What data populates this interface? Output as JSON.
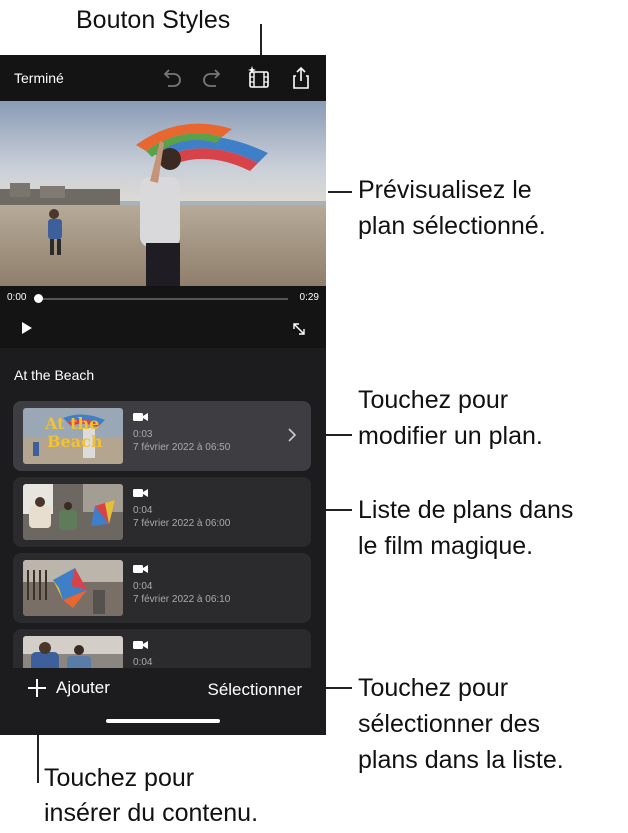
{
  "callouts": {
    "styles": "Bouton Styles",
    "preview_1": "Prévisualisez le",
    "preview_2": "plan sélectionné.",
    "edit_1": "Touchez pour",
    "edit_2": "modifier un plan.",
    "list_1": "Liste de plans dans",
    "list_2": "le film magique.",
    "select_1": "Touchez pour",
    "select_2": "sélectionner des",
    "select_3": "plans dans la liste.",
    "insert_1": "Touchez pour",
    "insert_2": "insérer du contenu."
  },
  "toolbar": {
    "done_label": "Terminé",
    "icons": [
      "undo-icon",
      "redo-icon",
      "styles-icon",
      "share-icon"
    ]
  },
  "player": {
    "time_start": "0:00",
    "time_end": "0:29",
    "progress": 0
  },
  "movie": {
    "title": "At the Beach",
    "clips": [
      {
        "thumb_text_1": "At the",
        "thumb_text_2": "Beach",
        "duration": "0:03",
        "date": "7 février 2022 à 06:50",
        "selected": true
      },
      {
        "duration": "0:04",
        "date": "7 février 2022 à 06:00"
      },
      {
        "duration": "0:04",
        "date": "7 février 2022 à 06:10"
      },
      {
        "duration": "0:04"
      }
    ]
  },
  "bottom": {
    "add_label": "Ajouter",
    "select_label": "Sélectionner"
  },
  "colors": {
    "background": "#141414",
    "list_background": "#1c1c1e",
    "title_card_text": "#f2c230"
  }
}
